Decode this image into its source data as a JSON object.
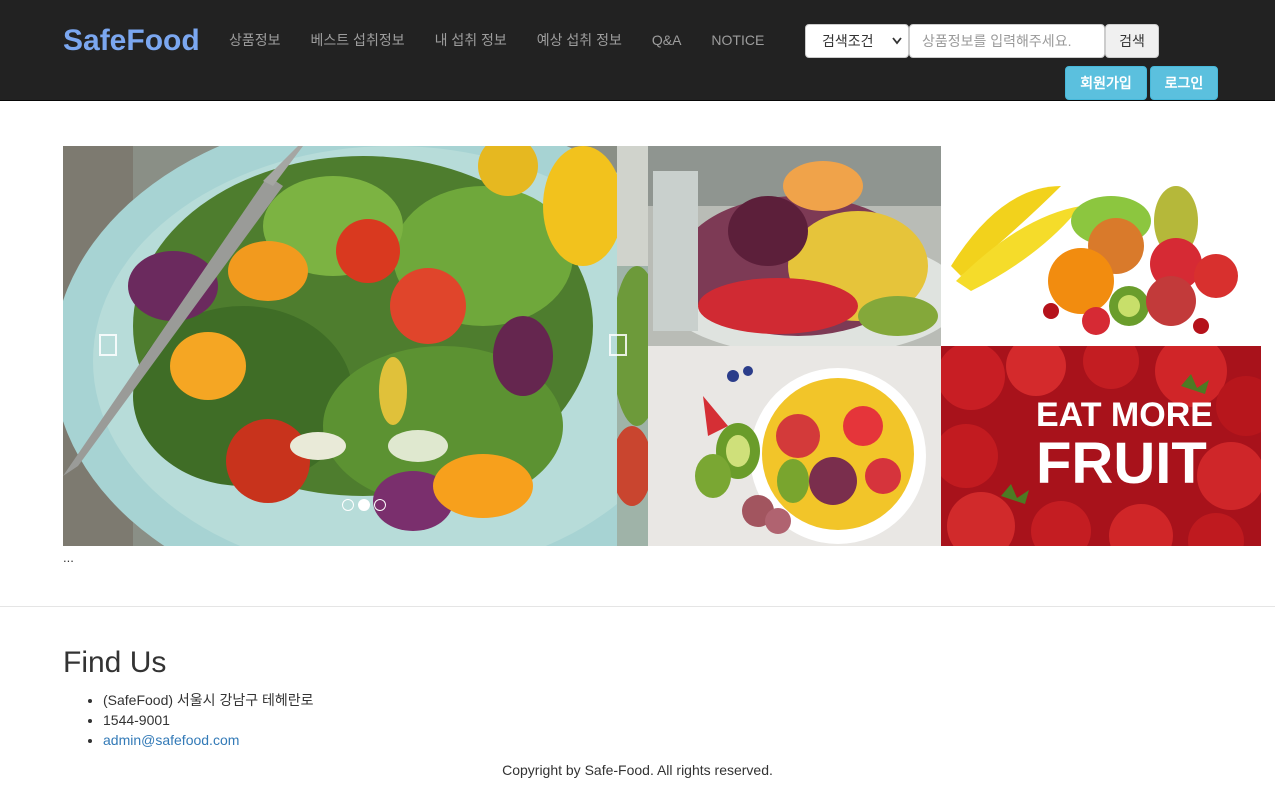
{
  "navbar": {
    "brand": "SafeFood",
    "links": [
      "상품정보",
      "베스트 섭취정보",
      "내 섭취 정보",
      "예상 섭취 정보",
      "Q&A",
      "NOTICE"
    ],
    "search": {
      "condition_selected": "검색조건",
      "placeholder": "상품정보를 입력해주세요.",
      "button_label": "검색"
    },
    "signup_label": "회원가입",
    "login_label": "로그인",
    "colors": {
      "background": "#222222",
      "brand": "#7ba7f0",
      "info_button": "#5bc0de"
    }
  },
  "carousel": {
    "slide_count": 3,
    "active_index": 1,
    "prev_icon": "chevron-left-icon",
    "next_icon": "chevron-right-icon"
  },
  "gallery": {
    "images": [
      "salad-image",
      "fruit-platter-image",
      "fruit-assortment-image",
      "fruit-bowl-image",
      "strawberries-image"
    ],
    "poster_text_line1": "EAT MORE",
    "poster_text_line2": "FRUIT"
  },
  "below_carousel_text": "...",
  "footer": {
    "title": "Find Us",
    "address": "(SafeFood) 서울시 강남구 테헤란로",
    "phone": "1544-9001",
    "email": "admin@safefood.com",
    "copyright": "Copyright by Safe-Food. All rights reserved."
  }
}
